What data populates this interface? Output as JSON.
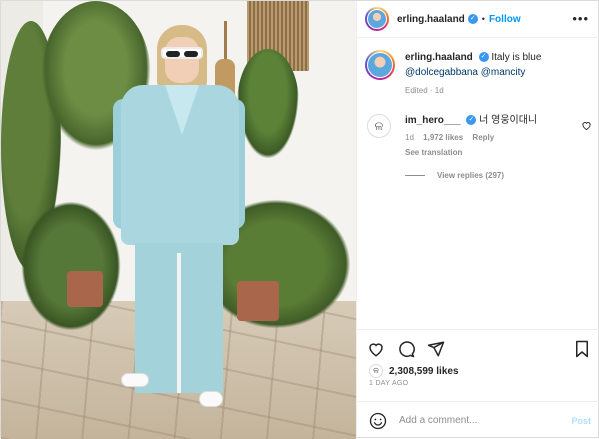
{
  "header": {
    "username": "erling.haaland",
    "verified_icon": "verified-badge-icon",
    "separator": "•",
    "follow_label": "Follow",
    "more_icon": "more-options-icon",
    "more_glyph": "•••"
  },
  "caption": {
    "username": "erling.haaland",
    "text": "Italy is blue",
    "tags": "@dolcegabbana @mancity",
    "edited": "Edited",
    "age": "1d"
  },
  "comment": {
    "username": "im_hero___",
    "text": "너 영웅이대니",
    "age": "1d",
    "likes": "1,972 likes",
    "reply_label": "Reply",
    "see_translation": "See translation",
    "view_replies": "View replies (297)"
  },
  "actions": {
    "icons": [
      "heart-icon",
      "comment-icon",
      "share-icon",
      "bookmark-icon"
    ],
    "likes": "2,308,599 likes",
    "time": "1 DAY AGO"
  },
  "add_comment": {
    "placeholder": "Add a comment...",
    "post_label": "Post"
  },
  "colors": {
    "accent": "#0095f6",
    "link": "#00376b",
    "muted": "#8e8e8e",
    "post_disabled": "#b2dffc",
    "verified": "#3897f0"
  }
}
